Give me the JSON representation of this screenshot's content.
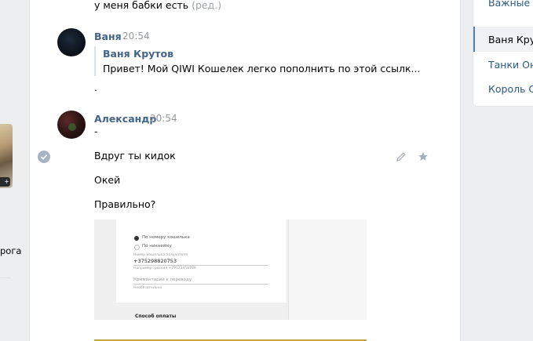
{
  "left": {
    "badge": "+",
    "caption": "рога"
  },
  "chat": {
    "prev_message": {
      "text": "у меня бабки есть",
      "edited": "(ред.)"
    },
    "messages": [
      {
        "author": "Ваня",
        "time": "20:54",
        "forward": {
          "author": "Ваня Крутов",
          "text": "Привет! Мой QIWI Кошелек легко пополнить по этой ссылк..."
        },
        "text": "."
      },
      {
        "author": "Александр",
        "time": "20:54",
        "lines": [
          "-",
          "Вдруг ты кидок",
          "Окей",
          "Правильно?"
        ]
      }
    ],
    "screenshot": {
      "radio1": "По номеру кошелька",
      "radio2": "По никнейму",
      "phone_label": "Номер кошелька получателя",
      "phone": "+375298820753",
      "hint": "Например: россия +79123456789",
      "comment_placeholder": "Комментарий к переводу",
      "comment_hint": "Необязательно",
      "payment": "Способ оплаты"
    }
  },
  "right_menu": {
    "items": [
      {
        "label": "Важные",
        "active": false
      },
      {
        "label": "Ваня Крутов",
        "active": true
      },
      {
        "label": "Танки Онлайн",
        "active": false
      },
      {
        "label": "Король С",
        "active": false
      }
    ]
  }
}
